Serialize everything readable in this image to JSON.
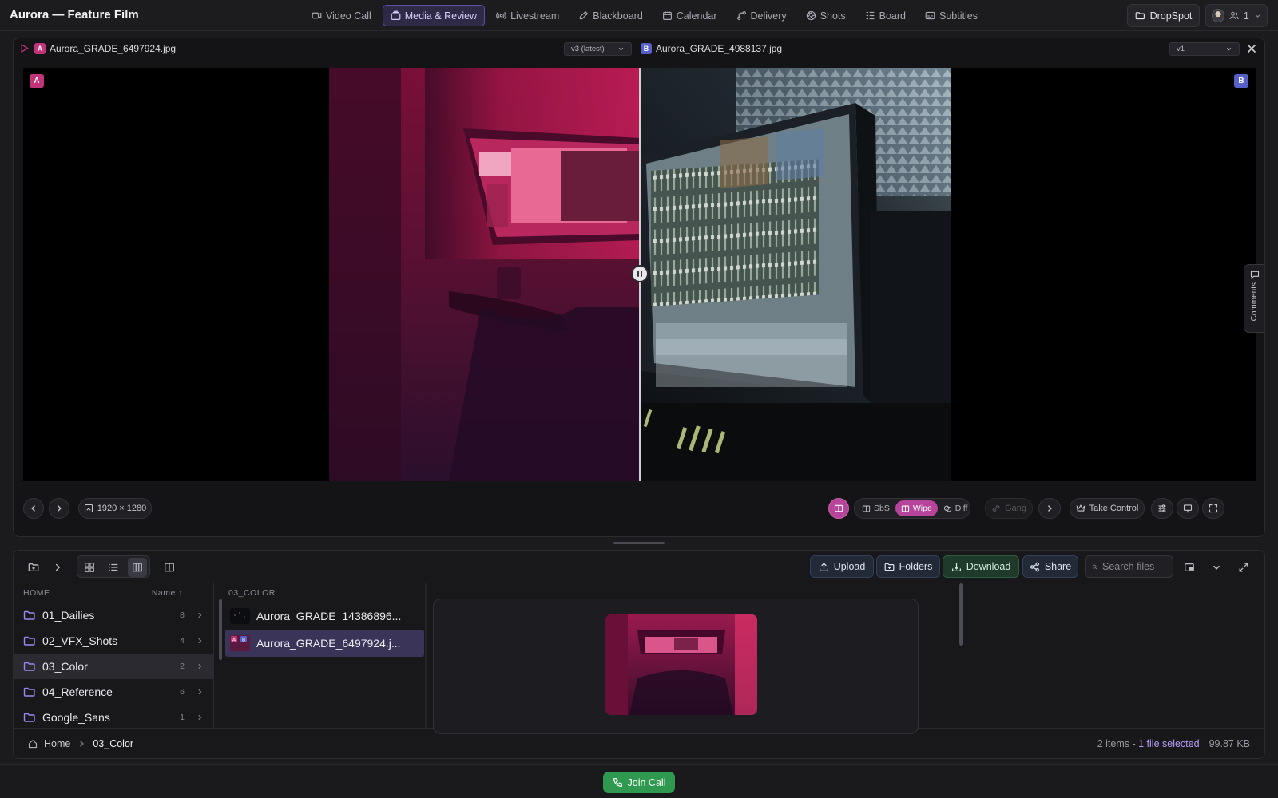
{
  "app": {
    "title": "Aurora — Feature Film"
  },
  "nav": [
    {
      "label": "Video Call",
      "icon": "video-icon",
      "active": false
    },
    {
      "label": "Media & Review",
      "icon": "media-icon",
      "active": true
    },
    {
      "label": "Livestream",
      "icon": "broadcast-icon",
      "active": false
    },
    {
      "label": "Blackboard",
      "icon": "pen-icon",
      "active": false
    },
    {
      "label": "Calendar",
      "icon": "calendar-icon",
      "active": false
    },
    {
      "label": "Delivery",
      "icon": "delivery-icon",
      "active": false
    },
    {
      "label": "Shots",
      "icon": "aperture-icon",
      "active": false
    },
    {
      "label": "Board",
      "icon": "board-icon",
      "active": false
    },
    {
      "label": "Subtitles",
      "icon": "subtitles-icon",
      "active": false
    }
  ],
  "header": {
    "dropspot_label": "DropSpot",
    "participant_count": "1"
  },
  "viewer": {
    "left_badge": "A",
    "left_file": "Aurora_GRADE_6497924.jpg",
    "left_version": "v3 (latest)",
    "right_badge": "B",
    "right_file": "Aurora_GRADE_4988137.jpg",
    "right_version": "v1",
    "resolution": "1920 × 1280",
    "compare_modes": [
      "SbS",
      "Wipe",
      "Diff"
    ],
    "active_mode": "Wipe",
    "gang_label": "Gang",
    "take_control_label": "Take Control",
    "comments_label": "Comments"
  },
  "browser": {
    "actions": {
      "upload": "Upload",
      "folders": "Folders",
      "download": "Download",
      "share": "Share"
    },
    "search_placeholder": "Search files",
    "col1_header": "HOME",
    "sort_label": "Name ↑",
    "folders": [
      {
        "name": "01_Dailies",
        "count": "8",
        "selected": false
      },
      {
        "name": "02_VFX_Shots",
        "count": "4",
        "selected": false
      },
      {
        "name": "03_Color",
        "count": "2",
        "selected": true
      },
      {
        "name": "04_Reference",
        "count": "6",
        "selected": false
      },
      {
        "name": "Google_Sans",
        "count": "1",
        "selected": false
      }
    ],
    "col2_header": "03_COLOR",
    "files": [
      {
        "name": "Aurora_GRADE_14386896...",
        "selected": false
      },
      {
        "name": "Aurora_GRADE_6497924.j...",
        "selected": true
      }
    ],
    "breadcrumb": [
      "Home",
      "03_Color"
    ],
    "status_items": "2 items - ",
    "status_selected": "1 file selected",
    "status_size": "99.87 KB"
  },
  "footer": {
    "join_label": "Join Call"
  },
  "colors": {
    "accent": "#6a58c4",
    "badge_a": "#c2347a",
    "badge_b": "#5560c8",
    "wipe_active": "#b6449a",
    "join": "#2f9a4f"
  }
}
